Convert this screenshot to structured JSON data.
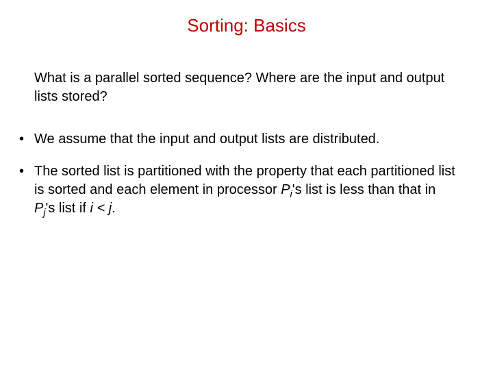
{
  "title": "Sorting: Basics",
  "intro": "What is a parallel sorted sequence? Where are the input and output lists stored?",
  "bullets": {
    "b1": "We assume that the input and output lists are distributed.",
    "b2_part1": "The sorted list is partitioned with the property that each partitioned list is sorted and each element in processor ",
    "b2_P1": "P",
    "b2_i": "i",
    "b2_part2": "'s list is less than that in ",
    "b2_P2": "P",
    "b2_j": "j",
    "b2_part3": "'s list if ",
    "b2_cond_i": "i",
    "b2_lt": " < ",
    "b2_cond_j": "j",
    "b2_end": "."
  }
}
